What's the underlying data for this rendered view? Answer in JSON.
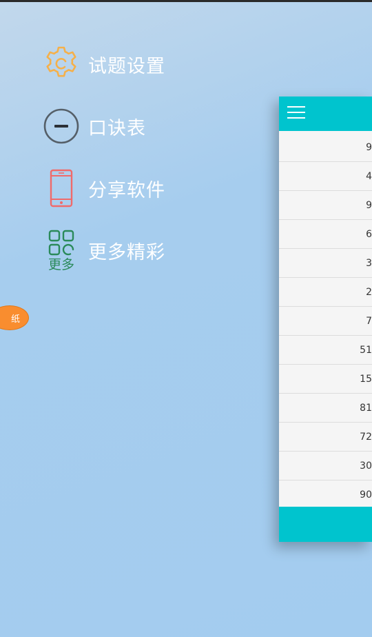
{
  "menu": {
    "items": [
      {
        "label": "试题设置",
        "icon": "gear-icon",
        "color": "#f5b04a"
      },
      {
        "label": "口诀表",
        "icon": "minus-circle-icon",
        "color": "#555f68"
      },
      {
        "label": "分享软件",
        "icon": "phone-icon",
        "color": "#f06a6a"
      },
      {
        "label": "更多精彩",
        "icon": "apps-more-icon",
        "color": "#2a8a5a",
        "icon_text": "更多"
      }
    ]
  },
  "tag": {
    "label": "纸",
    "color": "#f98d2f"
  },
  "panel": {
    "accent": "#00c4ce",
    "rows": [
      "9",
      "4",
      "9",
      "6",
      "3",
      "2",
      "7",
      "51",
      "15",
      "81",
      "72",
      "30",
      "90"
    ]
  }
}
